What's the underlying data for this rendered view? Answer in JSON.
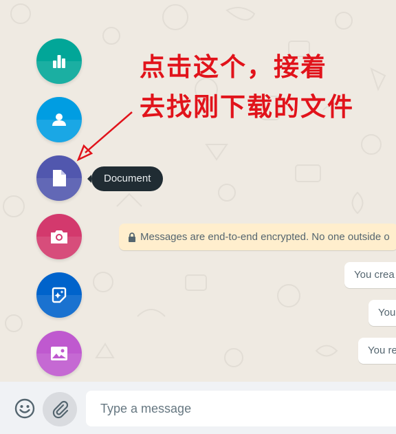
{
  "annotation": {
    "line1": "点击这个，接着",
    "line2": "去找刚下载的文件",
    "color": "#e1131b"
  },
  "attach_menu": {
    "items": [
      {
        "id": "poll",
        "icon": "poll-icon",
        "color": "#02a698"
      },
      {
        "id": "contact",
        "icon": "contact-icon",
        "color": "#009de2"
      },
      {
        "id": "document",
        "icon": "document-icon",
        "color": "#5157ae"
      },
      {
        "id": "camera",
        "icon": "camera-icon",
        "color": "#d3396d"
      },
      {
        "id": "sticker",
        "icon": "sticker-icon",
        "color": "#0063cb"
      },
      {
        "id": "photos",
        "icon": "photos-icon",
        "color": "#bf59cf"
      }
    ],
    "tooltip": "Document"
  },
  "chat": {
    "encryption_notice": "Messages are end-to-end encrypted. No one outside o",
    "system_messages": [
      "You crea",
      "You",
      "You re"
    ]
  },
  "composer": {
    "placeholder": "Type a message"
  },
  "colors": {
    "wallpaper": "#efeae2",
    "footer": "#f0f2f5",
    "tooltip_bg": "#202c33",
    "notice_bg": "#ffeecd"
  }
}
